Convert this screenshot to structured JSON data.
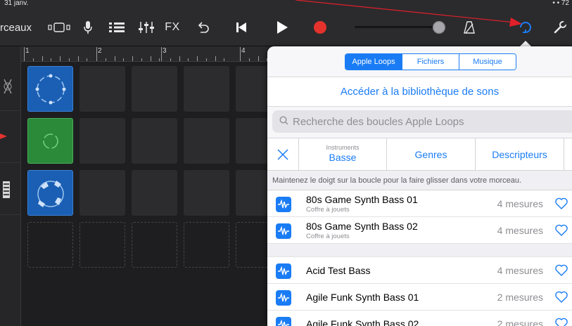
{
  "statusbar": {
    "time": "31 janv.",
    "right": "• • 72"
  },
  "toolbar": {
    "songs_label": "rceaux",
    "fx_label": "FX"
  },
  "ruler": {
    "bars": [
      "1",
      "2",
      "3",
      "4"
    ]
  },
  "segmented": {
    "items": [
      "Apple Loops",
      "Fichiers",
      "Musique"
    ],
    "selected": "Apple Loops"
  },
  "browse_link": "Accéder à la bibliothèque de sons",
  "search": {
    "placeholder": "Recherche des boucles Apple Loops"
  },
  "filter": {
    "instrument_caption": "Instruments",
    "instrument_value": "Basse",
    "genres": "Genres",
    "descriptors": "Descripteurs"
  },
  "hint": "Maintenez le doigt sur la boucle pour la faire glisser dans votre morceau.",
  "loops": [
    {
      "name": "80s Game Synth Bass 01",
      "pack": "Coffre à jouets",
      "length": "4 mesures"
    },
    {
      "name": "80s Game Synth Bass 02",
      "pack": "Coffre à jouets",
      "length": "4 mesures"
    },
    {
      "name": "Acid Test Bass",
      "pack": "",
      "length": "4 mesures"
    },
    {
      "name": "Agile Funk Synth Bass 01",
      "pack": "",
      "length": "2 mesures"
    },
    {
      "name": "Agile Funk Synth Bass 02",
      "pack": "",
      "length": "2 mesures"
    }
  ],
  "colors": {
    "accent": "#1a7cf5",
    "record": "#e5322d",
    "blue_cell": "#1a5fb4",
    "green_cell": "#2a8a3a",
    "arrow": "#e0202a"
  },
  "icons": [
    "view-toggle-icon",
    "microphone-icon",
    "mixer-icon",
    "eq-icon",
    "undo-icon",
    "rewind-icon",
    "play-icon",
    "record-icon",
    "metronome-icon",
    "loop-browser-icon",
    "settings-wrench-icon",
    "close-icon",
    "search-icon",
    "waveform-icon",
    "heart-icon"
  ]
}
